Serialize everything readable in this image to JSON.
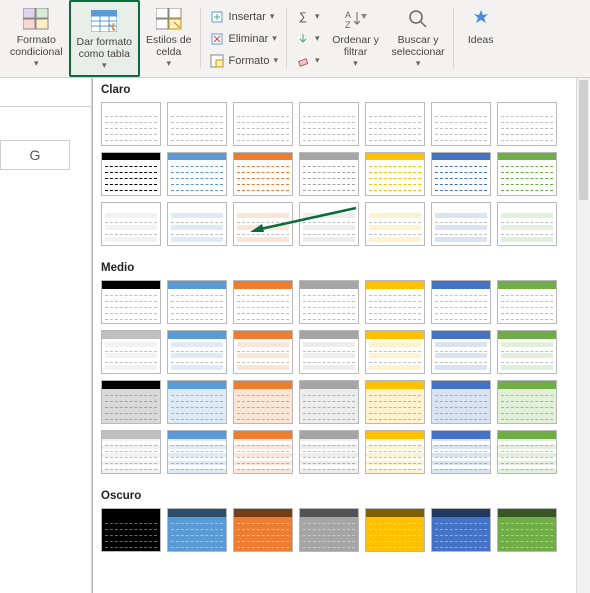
{
  "ribbon": {
    "conditional_format": "Formato\ncondicional",
    "format_table": "Dar formato\ncomo tabla",
    "cell_styles": "Estilos de\ncelda",
    "insert": "Insertar",
    "delete": "Eliminar",
    "format": "Formato",
    "sort_filter": "Ordenar y\nfiltrar",
    "find_select": "Buscar y\nseleccionar",
    "ideas": "Ideas"
  },
  "columns": {
    "G": "G"
  },
  "gallery": {
    "section_light": "Claro",
    "section_medium": "Medio",
    "section_dark": "Oscuro"
  },
  "palette": {
    "none": {
      "hc": "#bfbfbf",
      "band": "#f2f2f2"
    },
    "blue": {
      "hc": "#5b9bd5",
      "band": "#deebf7"
    },
    "orange": {
      "hc": "#ed7d31",
      "band": "#fbe5d6"
    },
    "gray": {
      "hc": "#a5a5a5",
      "band": "#ededed"
    },
    "gold": {
      "hc": "#ffc000",
      "band": "#fff2cc"
    },
    "blue2": {
      "hc": "#4472c4",
      "band": "#dae3f3"
    },
    "green": {
      "hc": "#70ad47",
      "band": "#e2f0d9"
    },
    "black": {
      "hc": "#000000",
      "band": "#d9d9d9"
    }
  }
}
